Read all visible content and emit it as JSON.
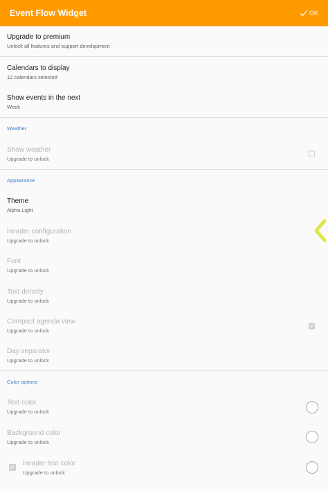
{
  "appbar": {
    "title": "Event Flow Widget",
    "ok_label": "OK"
  },
  "premium": {
    "title": "Upgrade to premium",
    "summary": "Unlock all features and support development"
  },
  "calendars": {
    "title": "Calendars to display",
    "summary": "12 calendars selected"
  },
  "show_events": {
    "title": "Show events in the next",
    "summary": "Week"
  },
  "weather": {
    "category": "Weather",
    "show_weather": {
      "title": "Show weather",
      "summary": "Upgrade to unlock",
      "checked": false
    }
  },
  "appearance": {
    "category": "Appearance",
    "theme": {
      "title": "Theme",
      "summary": "Alpha Light"
    },
    "header_config": {
      "title": "Header configuration",
      "summary": "Upgrade to unlock"
    },
    "font": {
      "title": "Font",
      "summary": "Upgrade to unlock"
    },
    "text_density": {
      "title": "Text density",
      "summary": "Upgrade to unlock"
    },
    "compact_agenda": {
      "title": "Compact agenda view",
      "summary": "Upgrade to unlock",
      "checked": true
    },
    "day_separator": {
      "title": "Day separator",
      "summary": "Upgrade to unlock"
    }
  },
  "colors": {
    "category": "Color options",
    "text_color": {
      "title": "Text color",
      "summary": "Upgrade to unlock"
    },
    "background_color": {
      "title": "Background color",
      "summary": "Upgrade to unlock"
    },
    "header_text_color": {
      "title": "Header text color",
      "summary": "Upgrade to unlock",
      "checked": true
    }
  },
  "theme_colors": {
    "accent": "#ff9a00",
    "category": "#3f7fc3",
    "handle": "#dfe64a"
  }
}
